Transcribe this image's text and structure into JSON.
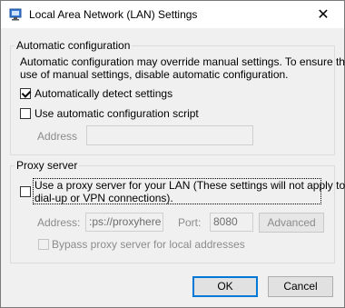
{
  "window": {
    "title": "Local Area Network (LAN) Settings",
    "close_glyph": "✕",
    "icon": "network-settings-icon"
  },
  "auto_config": {
    "legend": "Automatic configuration",
    "description_line1": "Automatic configuration may override manual settings.  To ensure the",
    "description_line2": "use of manual settings, disable automatic configuration.",
    "detect_label": "Automatically detect settings",
    "detect_checked": true,
    "script_label": "Use automatic configuration script",
    "script_checked": false,
    "address_label": "Address",
    "address_value": ""
  },
  "proxy": {
    "legend": "Proxy server",
    "use_proxy_line1": "Use a proxy server for your LAN (These settings will not apply to",
    "use_proxy_line2": "dial-up or VPN connections).",
    "use_proxy_checked": false,
    "address_label": "Address:",
    "address_value": ":ps://proxyhere",
    "port_label": "Port:",
    "port_value": "8080",
    "advanced_label": "Advanced",
    "bypass_label": "Bypass proxy server for local addresses",
    "bypass_checked": false
  },
  "buttons": {
    "ok_label": "OK",
    "cancel_label": "Cancel"
  }
}
